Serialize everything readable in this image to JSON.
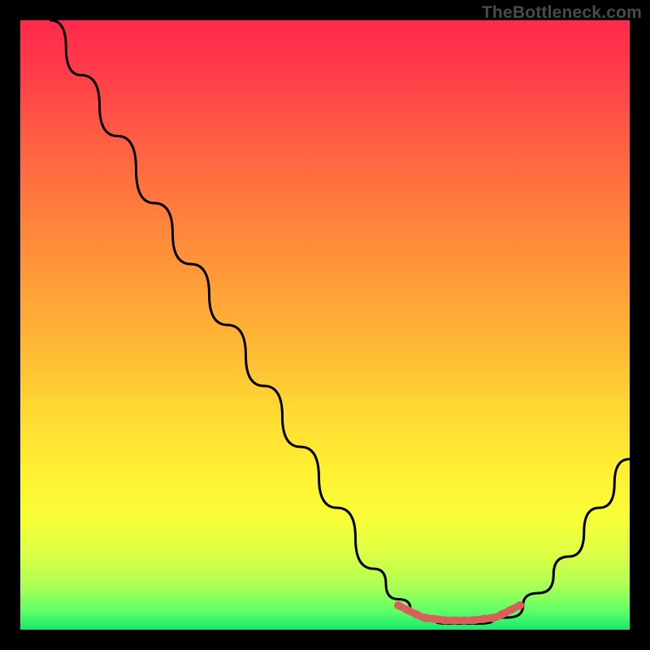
{
  "watermark": "TheBottleneck.com",
  "chart_data": {
    "type": "line",
    "title": "",
    "xlabel": "",
    "ylabel": "",
    "xlim": [
      0,
      100
    ],
    "ylim": [
      0,
      100
    ],
    "grid": false,
    "legend": false,
    "background_gradient": {
      "top": "#ff2a4d",
      "middle": "#ffd933",
      "bottom": "#17e86b"
    },
    "series": [
      {
        "name": "bottleneck-curve",
        "color": "#000000",
        "points": [
          {
            "x": 5,
            "y": 100
          },
          {
            "x": 10,
            "y": 91
          },
          {
            "x": 16,
            "y": 81
          },
          {
            "x": 22,
            "y": 70
          },
          {
            "x": 28,
            "y": 60
          },
          {
            "x": 34,
            "y": 50
          },
          {
            "x": 40,
            "y": 40
          },
          {
            "x": 46,
            "y": 30
          },
          {
            "x": 52,
            "y": 20
          },
          {
            "x": 58,
            "y": 10
          },
          {
            "x": 62,
            "y": 5
          },
          {
            "x": 66,
            "y": 2
          },
          {
            "x": 70,
            "y": 1
          },
          {
            "x": 75,
            "y": 1
          },
          {
            "x": 80,
            "y": 2
          },
          {
            "x": 85,
            "y": 6
          },
          {
            "x": 90,
            "y": 12
          },
          {
            "x": 95,
            "y": 20
          },
          {
            "x": 100,
            "y": 28
          }
        ]
      },
      {
        "name": "optimal-range-marker",
        "color": "#d9605a",
        "points": [
          {
            "x": 62,
            "y": 4
          },
          {
            "x": 66,
            "y": 2
          },
          {
            "x": 70,
            "y": 1.5
          },
          {
            "x": 74,
            "y": 1.5
          },
          {
            "x": 78,
            "y": 2
          },
          {
            "x": 82,
            "y": 4
          }
        ]
      }
    ]
  }
}
